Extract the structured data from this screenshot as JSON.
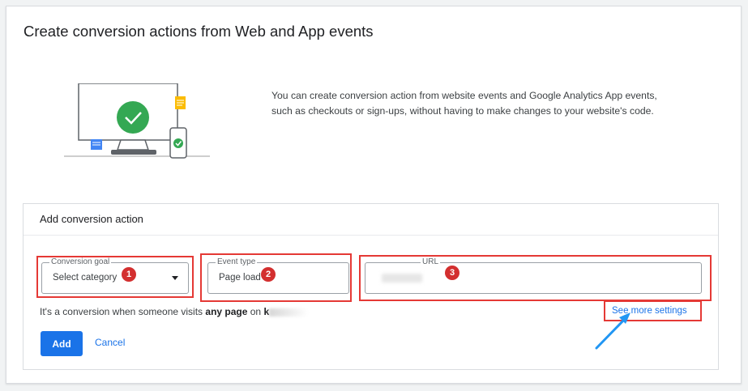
{
  "page": {
    "title": "Create conversion actions from Web and App events",
    "intro_line_1": "You can create conversion action from website events and Google Analytics App events,",
    "intro_line_2": "such as checkouts or sign-ups, without having to make changes to your website's code."
  },
  "panel": {
    "title": "Add conversion action",
    "fields": [
      {
        "legend": "Conversion goal",
        "value": "Select category",
        "badge": "1",
        "icon": "chevron-down-icon"
      },
      {
        "legend": "Event type",
        "value": "Page load",
        "badge": "2"
      },
      {
        "legend": "URL",
        "value": "",
        "badge": "3"
      }
    ],
    "info_prefix": "It's a conversion when someone visits ",
    "info_bold": "any page",
    "info_mid": " on ",
    "info_domain": "k",
    "see_more": "See more settings",
    "add_label": "Add",
    "cancel_label": "Cancel"
  },
  "colors": {
    "accent": "#1a73e8",
    "highlight": "#e53935",
    "badge": "#d32f2f",
    "success": "#34a853",
    "arrow": "#2196f3"
  }
}
